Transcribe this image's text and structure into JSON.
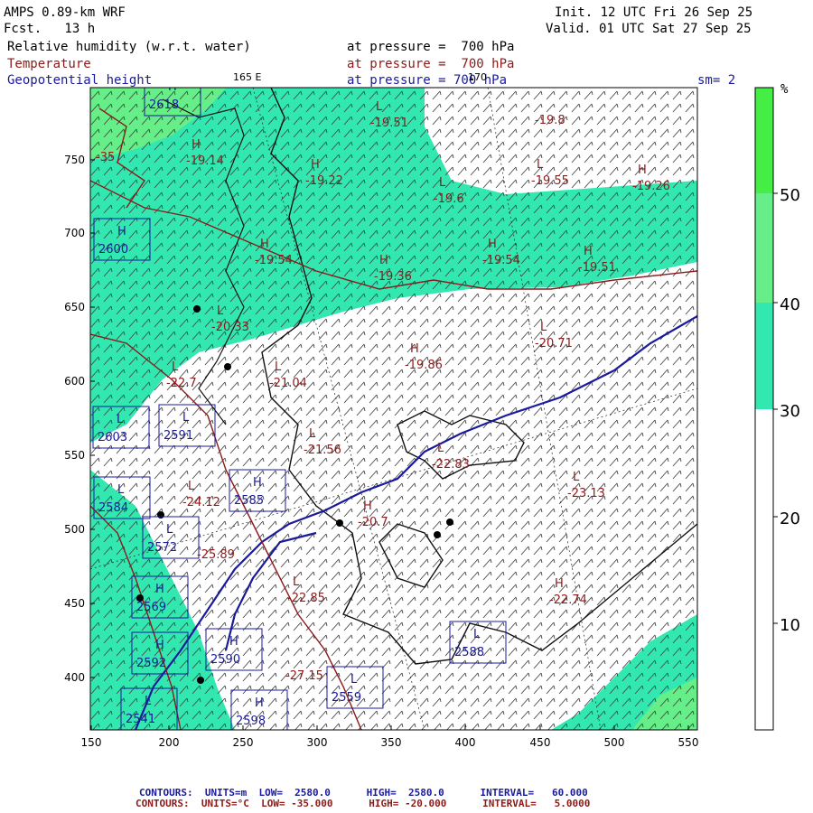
{
  "header": {
    "model": "AMPS 0.89-km WRF",
    "forecast": "Fcst.   13 h",
    "init": "Init. 12 UTC Fri 26 Sep 25",
    "valid": "Valid. 01 UTC Sat 27 Sep 25",
    "field1": "Relative humidity (w.r.t. water)",
    "field2": "Temperature",
    "field3": "Geopotential height",
    "level1": "at pressure =  700 hPa",
    "level2": "at pressure =  700 hPa",
    "level3": "at pressure = 700 hPa",
    "smoothing": "sm= 2",
    "lon165": "165 E",
    "lon170": "170"
  },
  "colorbar": {
    "unit": "%",
    "ticks": [
      "10",
      "20",
      "30",
      "40",
      "50"
    ],
    "colors": {
      "below30": "#ffffff",
      "30-40": "#33e8b0",
      "40-50": "#66ee88",
      "above50": "#44ee44"
    }
  },
  "axes": {
    "x_ticks": [
      "150",
      "200",
      "250",
      "300",
      "350",
      "400",
      "450",
      "500",
      "550"
    ],
    "y_ticks": [
      "400",
      "450",
      "500",
      "550",
      "600",
      "650",
      "700",
      "750"
    ]
  },
  "temperature_labels": [
    {
      "mark": "L",
      "value": "-19.51"
    },
    {
      "mark": "",
      "value": "-19.8"
    },
    {
      "mark": "H",
      "value": "-19.14"
    },
    {
      "mark": "H",
      "value": "-19.22"
    },
    {
      "mark": "L",
      "value": "-19.6"
    },
    {
      "mark": "L",
      "value": "-19.55"
    },
    {
      "mark": "H",
      "value": "-19.26"
    },
    {
      "mark": "H",
      "value": "-19.54"
    },
    {
      "mark": "H",
      "value": "-19.36"
    },
    {
      "mark": "H",
      "value": "-19.54"
    },
    {
      "mark": "H",
      "value": "-19.51"
    },
    {
      "mark": "L",
      "value": "-20.33"
    },
    {
      "mark": "L",
      "value": "-20.71"
    },
    {
      "mark": "H",
      "value": "-19.86"
    },
    {
      "mark": "L",
      "value": "-22.7"
    },
    {
      "mark": "L",
      "value": "-21.04"
    },
    {
      "mark": "L",
      "value": "-21.56"
    },
    {
      "mark": "L",
      "value": "-22.83"
    },
    {
      "mark": "L",
      "value": "-23.13"
    },
    {
      "mark": "L",
      "value": "-24.12"
    },
    {
      "mark": "H",
      "value": "-20.7"
    },
    {
      "mark": "L",
      "value": "-22.85"
    },
    {
      "mark": "H",
      "value": "-22.74"
    },
    {
      "mark": "",
      "value": "-25.89"
    },
    {
      "mark": "",
      "value": "-27.15"
    },
    {
      "mark": "",
      "value": "-35"
    }
  ],
  "height_labels": [
    {
      "mark": "H",
      "value": "2618"
    },
    {
      "mark": "H",
      "value": "2600"
    },
    {
      "mark": "L",
      "value": "2603"
    },
    {
      "mark": "L",
      "value": "2591"
    },
    {
      "mark": "H",
      "value": "2585"
    },
    {
      "mark": "L",
      "value": "2584"
    },
    {
      "mark": "L",
      "value": "2572"
    },
    {
      "mark": "H",
      "value": "2569"
    },
    {
      "mark": "H",
      "value": "2590"
    },
    {
      "mark": "L",
      "value": "2588"
    },
    {
      "mark": "H",
      "value": "2592"
    },
    {
      "mark": "L",
      "value": "2541"
    },
    {
      "mark": "H",
      "value": "2598"
    },
    {
      "mark": "L",
      "value": "2559"
    }
  ],
  "footer": {
    "line1": "CONTOURS:  UNITS=m  LOW=  2580.0      HIGH=  2580.0      INTERVAL=   60.000",
    "line2": "CONTOURS:  UNITS=°C  LOW= -35.000      HIGH= -20.000      INTERVAL=   5.0000"
  }
}
